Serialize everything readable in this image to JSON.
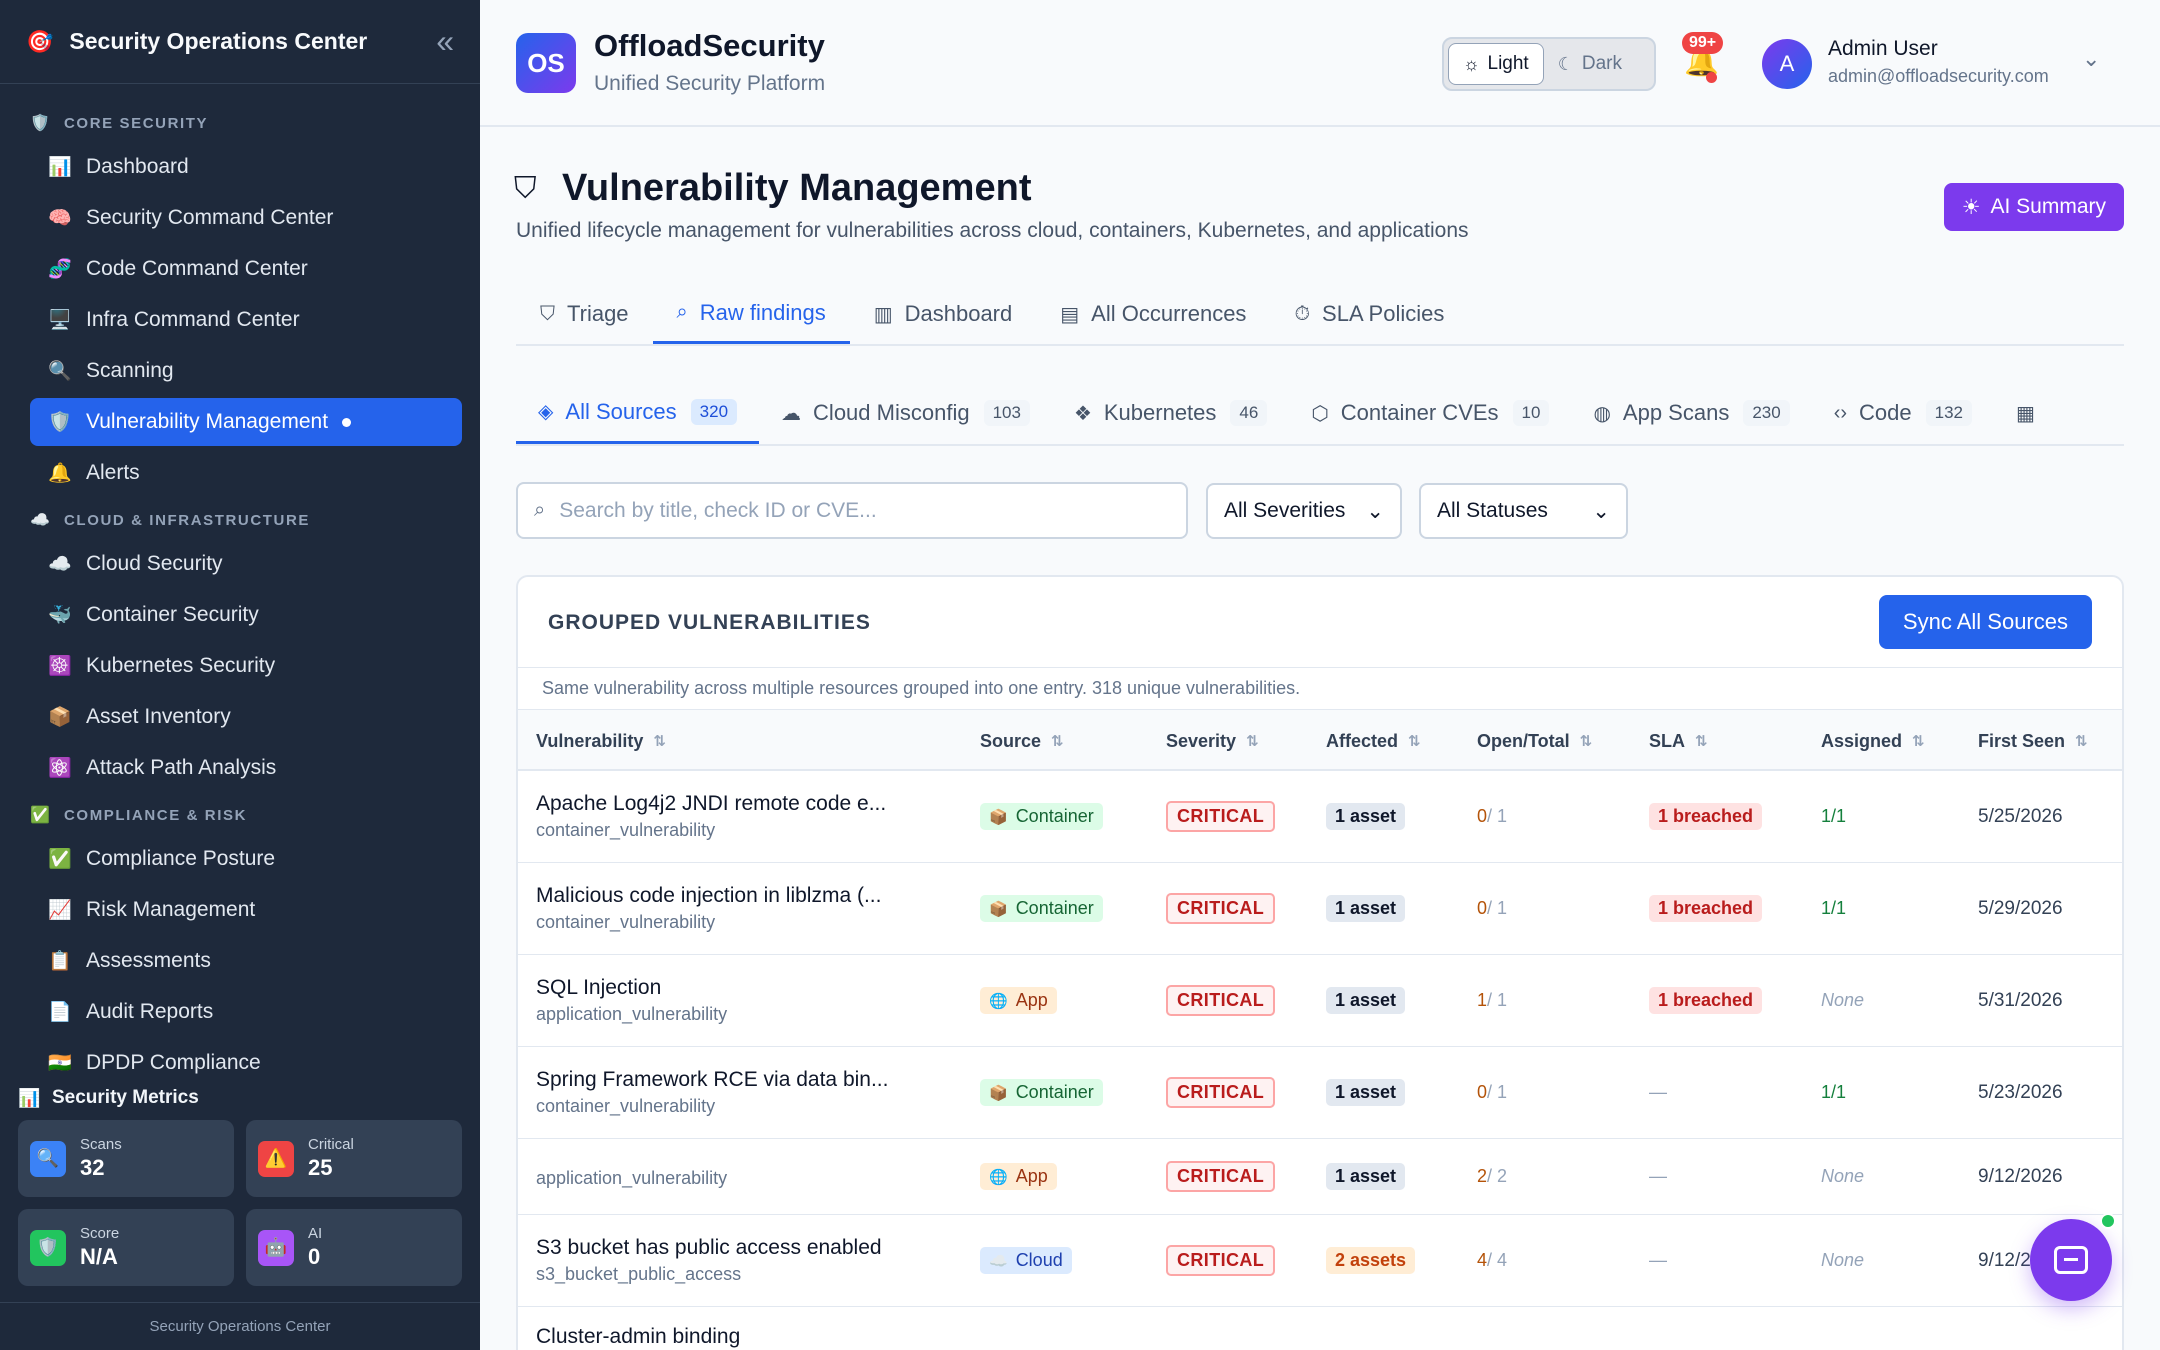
{
  "sidebar": {
    "title": "Security Operations Center",
    "logo_icon": "🎯",
    "collapse_icon": "«",
    "sections": [
      {
        "label": "CORE SECURITY",
        "icon": "🛡️",
        "items": [
          {
            "label": "Dashboard",
            "icon": "📊"
          },
          {
            "label": "Security Command Center",
            "icon": "🧠"
          },
          {
            "label": "Code Command Center",
            "icon": "🧬"
          },
          {
            "label": "Infra Command Center",
            "icon": "🖥️"
          },
          {
            "label": "Scanning",
            "icon": "🔍"
          },
          {
            "label": "Vulnerability Management",
            "icon": "🛡️",
            "active": true
          },
          {
            "label": "Alerts",
            "icon": "🔔"
          }
        ]
      },
      {
        "label": "CLOUD & INFRASTRUCTURE",
        "icon": "☁️",
        "items": [
          {
            "label": "Cloud Security",
            "icon": "☁️"
          },
          {
            "label": "Container Security",
            "icon": "🐳"
          },
          {
            "label": "Kubernetes Security",
            "icon": "☸️"
          },
          {
            "label": "Asset Inventory",
            "icon": "📦"
          },
          {
            "label": "Attack Path Analysis",
            "icon": "⚛️"
          }
        ]
      },
      {
        "label": "COMPLIANCE & RISK",
        "icon": "✅",
        "items": [
          {
            "label": "Compliance Posture",
            "icon": "✅"
          },
          {
            "label": "Risk Management",
            "icon": "📈"
          },
          {
            "label": "Assessments",
            "icon": "📋"
          },
          {
            "label": "Audit Reports",
            "icon": "📄"
          },
          {
            "label": "DPDP Compliance",
            "icon": "🇮🇳"
          }
        ]
      }
    ],
    "metrics": {
      "title": "Security Metrics",
      "icon": "📊",
      "cards": [
        {
          "label": "Scans",
          "value": "32",
          "icon": "🔍",
          "color": "#3b82f6"
        },
        {
          "label": "Critical",
          "value": "25",
          "icon": "⚠️",
          "color": "#ef4444"
        },
        {
          "label": "Score",
          "value": "N/A",
          "icon": "🛡️",
          "color": "#22c55e"
        },
        {
          "label": "AI",
          "value": "0",
          "icon": "🤖",
          "color": "#a855f7"
        }
      ]
    },
    "footer": "Security Operations Center"
  },
  "header": {
    "logo_text": "OS",
    "brand": "OffloadSecurity",
    "tagline": "Unified Security Platform",
    "theme": {
      "light": "Light",
      "dark": "Dark",
      "light_icon": "☼",
      "dark_icon": "☾"
    },
    "notifications_badge": "99+",
    "user": {
      "initial": "A",
      "name": "Admin User",
      "email": "admin@offloadsecurity.com"
    }
  },
  "page": {
    "title": "Vulnerability Management",
    "description": "Unified lifecycle management for vulnerabilities across cloud, containers, Kubernetes, and applications",
    "ai_button": "AI Summary",
    "tabs": [
      {
        "label": "Triage",
        "icon": "⛉"
      },
      {
        "label": "Raw findings",
        "icon": "⌕",
        "active": true
      },
      {
        "label": "Dashboard",
        "icon": "▥"
      },
      {
        "label": "All Occurrences",
        "icon": "▤"
      },
      {
        "label": "SLA Policies",
        "icon": "⏱"
      }
    ],
    "source_tabs": [
      {
        "label": "All Sources",
        "count": "320",
        "icon": "◈",
        "active": true
      },
      {
        "label": "Cloud Misconfig",
        "count": "103",
        "icon": "☁"
      },
      {
        "label": "Kubernetes",
        "count": "46",
        "icon": "❖"
      },
      {
        "label": "Container CVEs",
        "count": "10",
        "icon": "⬡"
      },
      {
        "label": "App Scans",
        "count": "230",
        "icon": "◍"
      },
      {
        "label": "Code",
        "count": "132",
        "icon": "‹›"
      },
      {
        "label": "",
        "count": "",
        "icon": "▦"
      }
    ],
    "search_placeholder": "Search by title, check ID or CVE...",
    "severity_filter": "All Severities",
    "status_filter": "All Statuses"
  },
  "grouped": {
    "title": "GROUPED VULNERABILITIES",
    "sync_button": "Sync All Sources",
    "subtitle": "Same vulnerability across multiple resources grouped into one entry. 318 unique vulnerabilities.",
    "columns": [
      "Vulnerability",
      "Source",
      "Severity",
      "Affected",
      "Open/Total",
      "SLA",
      "Assigned",
      "First Seen"
    ],
    "rows": [
      {
        "title": "Apache Log4j2 JNDI remote code e...",
        "type": "container_vulnerability",
        "source": "Container",
        "source_kind": "container",
        "severity": "CRITICAL",
        "affected": "1 asset",
        "open": "0",
        "total": "/ 1",
        "sla": "1 breached",
        "assigned": "1/1",
        "first_seen": "5/25/2026"
      },
      {
        "title": "Malicious code injection in liblzma (...",
        "type": "container_vulnerability",
        "source": "Container",
        "source_kind": "container",
        "severity": "CRITICAL",
        "affected": "1 asset",
        "open": "0",
        "total": "/ 1",
        "sla": "1 breached",
        "assigned": "1/1",
        "first_seen": "5/29/2026"
      },
      {
        "title": "SQL Injection",
        "type": "application_vulnerability",
        "source": "App",
        "source_kind": "app",
        "severity": "CRITICAL",
        "affected": "1 asset",
        "open": "1",
        "total": "/ 1",
        "sla": "1 breached",
        "assigned": "None",
        "first_seen": "5/31/2026"
      },
      {
        "title": "Spring Framework RCE via data bin...",
        "type": "container_vulnerability",
        "source": "Container",
        "source_kind": "container",
        "severity": "CRITICAL",
        "affected": "1 asset",
        "open": "0",
        "total": "/ 1",
        "sla": "—",
        "assigned": "1/1",
        "first_seen": "5/23/2026"
      },
      {
        "title": "",
        "type": "application_vulnerability",
        "source": "App",
        "source_kind": "app",
        "severity": "CRITICAL",
        "affected": "1 asset",
        "open": "2",
        "total": "/ 2",
        "sla": "—",
        "assigned": "None",
        "first_seen": "9/12/2026"
      },
      {
        "title": "S3 bucket has public access enabled",
        "type": "s3_bucket_public_access",
        "source": "Cloud",
        "source_kind": "cloud",
        "severity": "CRITICAL",
        "affected": "2 assets",
        "open": "4",
        "total": "/ 4",
        "sla": "—",
        "assigned": "None",
        "first_seen": "9/12/2026"
      },
      {
        "title": "Cluster-admin binding",
        "type": "",
        "source": "",
        "source_kind": "app",
        "severity": "",
        "affected": "",
        "open": "",
        "total": "",
        "sla": "",
        "assigned": "",
        "first_seen": ""
      }
    ]
  }
}
